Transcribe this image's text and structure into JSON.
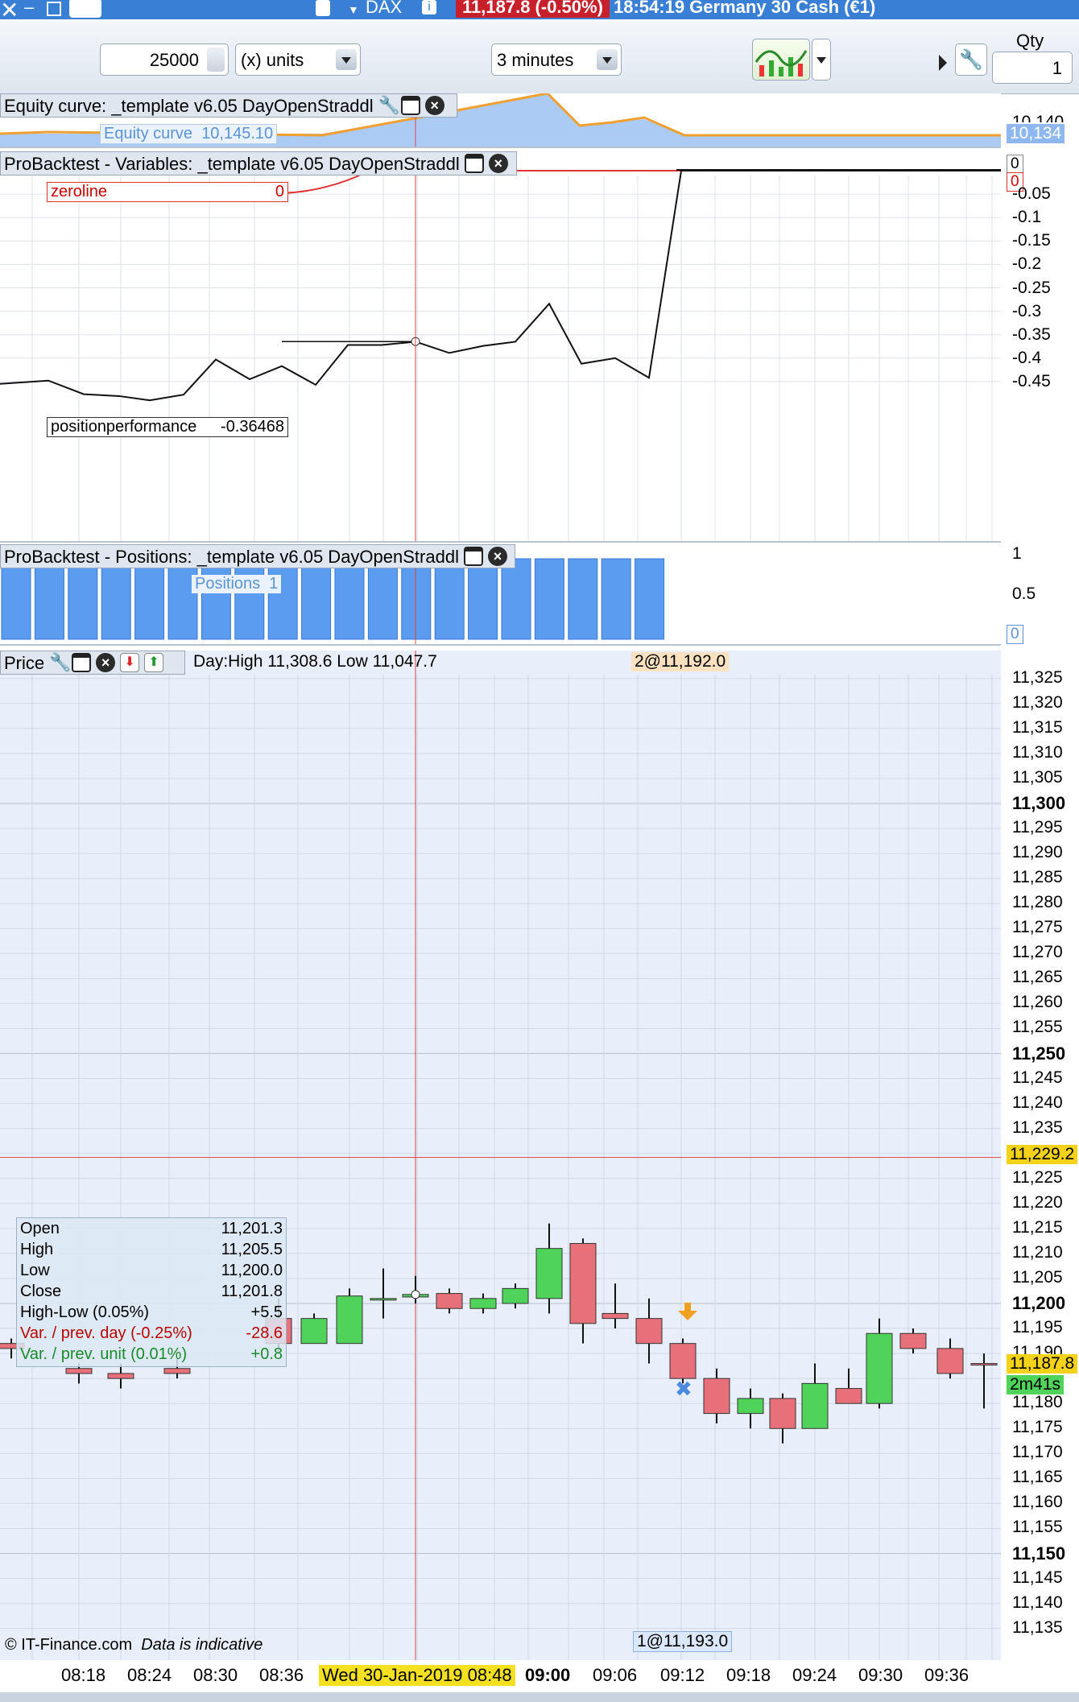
{
  "titlebar": {
    "close_glyph": "✕",
    "minimize_glyph": "–",
    "instrument": "DAX",
    "price_badge": "11,187.8 (-0.50%)",
    "time_and_name": "18:54:19 Germany 30 Cash (€1)"
  },
  "toolbar": {
    "quantity_value": "25000",
    "units_label": "(x) units",
    "timeframe_label": "3 minutes",
    "qty_label": "Qty",
    "qty_value": "1"
  },
  "equity_panel": {
    "title": "Equity curve: _template v6.05 DayOpenStraddl",
    "legend_label": "Equity curve",
    "legend_value": "10,145.10",
    "axis_top_partial": "10,140",
    "axis_current": "10,134",
    "colors": {
      "area": "#8fb8f0",
      "line": "#f0a030"
    }
  },
  "variables_panel": {
    "title": "ProBacktest - Variables: _template v6.05 DayOpenStraddl",
    "zeroline_label": "zeroline",
    "zeroline_value": "0",
    "perf_label": "positionperformance",
    "perf_value": "-0.36468",
    "axis_zero_black": "0",
    "axis_zero_red": "0",
    "axis_ticks": [
      "-0.05",
      "-0.1",
      "-0.15",
      "-0.2",
      "-0.25",
      "-0.3",
      "-0.35",
      "-0.4",
      "-0.45"
    ],
    "series_values": [
      -0.455,
      -0.448,
      -0.477,
      -0.481,
      -0.49,
      -0.478,
      -0.403,
      -0.445,
      -0.417,
      -0.457,
      -0.372,
      -0.372,
      -0.365,
      -0.389,
      -0.374,
      -0.365,
      -0.284,
      -0.412,
      -0.4,
      -0.442,
      0,
      0,
      0,
      0,
      0,
      0,
      0,
      0,
      0,
      0
    ]
  },
  "positions_panel": {
    "title": "ProBacktest - Positions: _template v6.05 DayOpenStraddl",
    "legend_label": "Positions",
    "legend_value": "1",
    "axis_ticks": [
      "1",
      "0.5"
    ],
    "axis_current": "0",
    "bar_values": [
      1,
      1,
      1,
      1,
      1,
      1,
      1,
      1,
      1,
      1,
      1,
      1,
      1,
      1,
      1,
      1,
      1,
      1,
      1,
      1
    ]
  },
  "price_panel": {
    "title": "Price",
    "day_range": "Day:High 11,308.6 Low 11,047.7",
    "order_top": "2@11,192.0",
    "order_bottom": "1@11,193.0",
    "axis_ticks": [
      "11,325",
      "11,320",
      "11,315",
      "11,310",
      "11,305",
      "11,300",
      "11,295",
      "11,290",
      "11,285",
      "11,280",
      "11,275",
      "11,270",
      "11,265",
      "11,260",
      "11,255",
      "11,250",
      "11,245",
      "11,240",
      "11,235",
      "11,225",
      "11,220",
      "11,215",
      "11,210",
      "11,205",
      "11,200",
      "11,195",
      "11,180",
      "11,175",
      "11,170",
      "11,165",
      "11,160",
      "11,155",
      "11,150",
      "11,145",
      "11,140",
      "11,135",
      "11,190"
    ],
    "crosshair_price": "11,229.2",
    "last_price": "11,187.8",
    "countdown": "2m41s",
    "colors": {
      "up": "#4fd35a",
      "down": "#e8707a",
      "crosshair": "#e04040"
    }
  },
  "ohlc": {
    "open_label": "Open",
    "open_value": "11,201.3",
    "high_label": "High",
    "high_value": "11,205.5",
    "low_label": "Low",
    "low_value": "11,200.0",
    "close_label": "Close",
    "close_value": "11,201.8",
    "range_label": "High-Low (0.05%)",
    "range_value": "+5.5",
    "var_day_label": "Var. / prev. day (-0.25%)",
    "var_day_value": "-28.6",
    "var_unit_label": "Var. / prev. unit (0.01%)",
    "var_unit_value": "+0.8"
  },
  "footer": {
    "copyright": "© IT-Finance.com",
    "disclaimer": "Data is indicative"
  },
  "time_axis": {
    "labels": [
      "08:18",
      "08:24",
      "08:30",
      "08:36",
      "09:00",
      "09:06",
      "09:12",
      "09:18",
      "09:24",
      "09:30",
      "09:36"
    ],
    "crosshair_label": "Wed 30-Jan-2019 08:48"
  }
}
